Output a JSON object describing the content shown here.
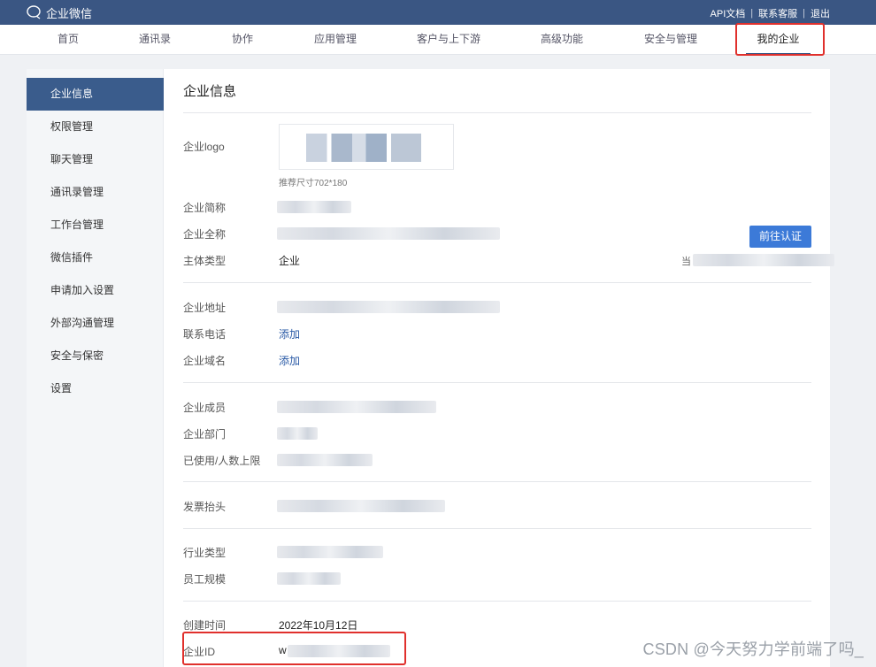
{
  "topbar": {
    "brand": "企业微信",
    "links": [
      "API文档",
      "联系客服",
      "退出"
    ],
    "separator": "|"
  },
  "nav": {
    "items": [
      "首页",
      "通讯录",
      "协作",
      "应用管理",
      "客户与上下游",
      "高级功能",
      "安全与管理",
      "我的企业"
    ],
    "active_index": 7
  },
  "sidebar": {
    "items": [
      "企业信息",
      "权限管理",
      "聊天管理",
      "通讯录管理",
      "工作台管理",
      "微信插件",
      "申请加入设置",
      "外部沟通管理",
      "安全与保密",
      "设置"
    ],
    "active_index": 0
  },
  "content": {
    "title": "企业信息",
    "logo_label": "企业logo",
    "logo_hint": "推荐尺寸702*180",
    "short_name_label": "企业简称",
    "full_name_label": "企业全称",
    "verify_button": "前往认证",
    "type_label": "主体类型",
    "type_value": "企业",
    "current_prefix": "当",
    "address_label": "企业地址",
    "phone_label": "联系电话",
    "phone_action": "添加",
    "domain_label": "企业域名",
    "domain_action": "添加",
    "members_label": "企业成员",
    "departments_label": "企业部门",
    "usage_label": "已使用/人数上限",
    "invoice_label": "发票抬头",
    "industry_label": "行业类型",
    "staff_scale_label": "员工规模",
    "created_label": "创建时间",
    "created_value": "2022年10月12日",
    "corp_id_label": "企业ID",
    "corp_id_prefix": "w"
  },
  "watermark": "CSDN @今天努力学前端了吗_",
  "colors": {
    "topbar": "#3a5683",
    "sidebar_active": "#3a5c8c",
    "button": "#3c7ad8",
    "highlight": "#e0302c",
    "link": "#2a5aa6"
  }
}
